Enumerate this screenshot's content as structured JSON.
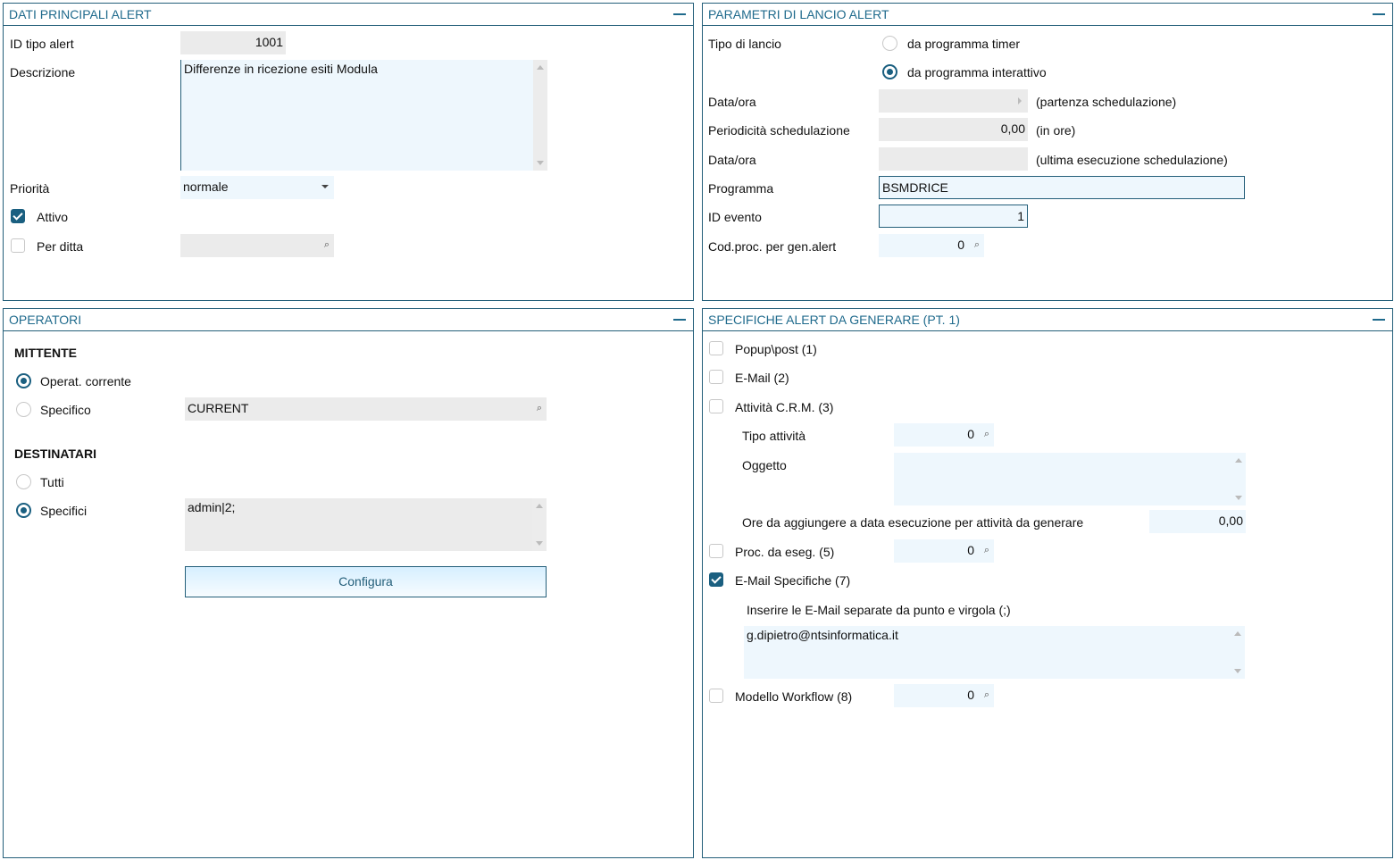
{
  "dati": {
    "title": "DATI PRINCIPALI ALERT",
    "id_label": "ID tipo alert",
    "id_value": "1001",
    "desc_label": "Descrizione",
    "desc_value": "Differenze in ricezione esiti Modula",
    "prio_label": "Priorità",
    "prio_value": "normale",
    "attivo_label": "Attivo",
    "attivo_checked": true,
    "ditta_label": "Per ditta",
    "ditta_checked": false
  },
  "parametri": {
    "title": "PARAMETRI DI LANCIO ALERT",
    "tipo_label": "Tipo di lancio",
    "opt_timer": "da programma timer",
    "opt_interattivo": "da programma interattivo",
    "selected": "interattivo",
    "data1_label": "Data/ora",
    "data1_note": "(partenza schedulazione)",
    "period_label": "Periodicità schedulazione",
    "period_value": "0,00",
    "period_note": "(in ore)",
    "data2_label": "Data/ora",
    "data2_note": "(ultima esecuzione schedulazione)",
    "prog_label": "Programma",
    "prog_value": "BSMDRICE",
    "evento_label": "ID evento",
    "evento_value": "1",
    "codproc_label": "Cod.proc. per gen.alert",
    "codproc_value": "0"
  },
  "operatori": {
    "title": "OPERATORI",
    "mittente": "MITTENTE",
    "opt_corrente": "Operat. corrente",
    "opt_specifico": "Specifico",
    "specifico_value": "CURRENT",
    "destinatari": "DESTINATARI",
    "opt_tutti": "Tutti",
    "opt_specifici": "Specifici",
    "specifici_value": "admin|2;",
    "configura": "Configura"
  },
  "specifiche": {
    "title": "SPECIFICHE ALERT DA GENERARE (PT. 1)",
    "popup": "Popup\\post (1)",
    "email": "E-Mail (2)",
    "crm": "Attività C.R.M. (3)",
    "tipo_att_label": "Tipo attività",
    "tipo_att_value": "0",
    "oggetto_label": "Oggetto",
    "ore_label": "Ore da aggiungere a data esecuzione per attività da generare",
    "ore_value": "0,00",
    "proc": "Proc. da eseg. (5)",
    "proc_value": "0",
    "email_spec": "E-Mail Specifiche (7)",
    "email_spec_checked": true,
    "email_hint": "Inserire le E-Mail separate da  punto e virgola (;)",
    "email_value": "g.dipietro@ntsinformatica.it",
    "workflow": "Modello Workflow (8)",
    "workflow_value": "0"
  }
}
